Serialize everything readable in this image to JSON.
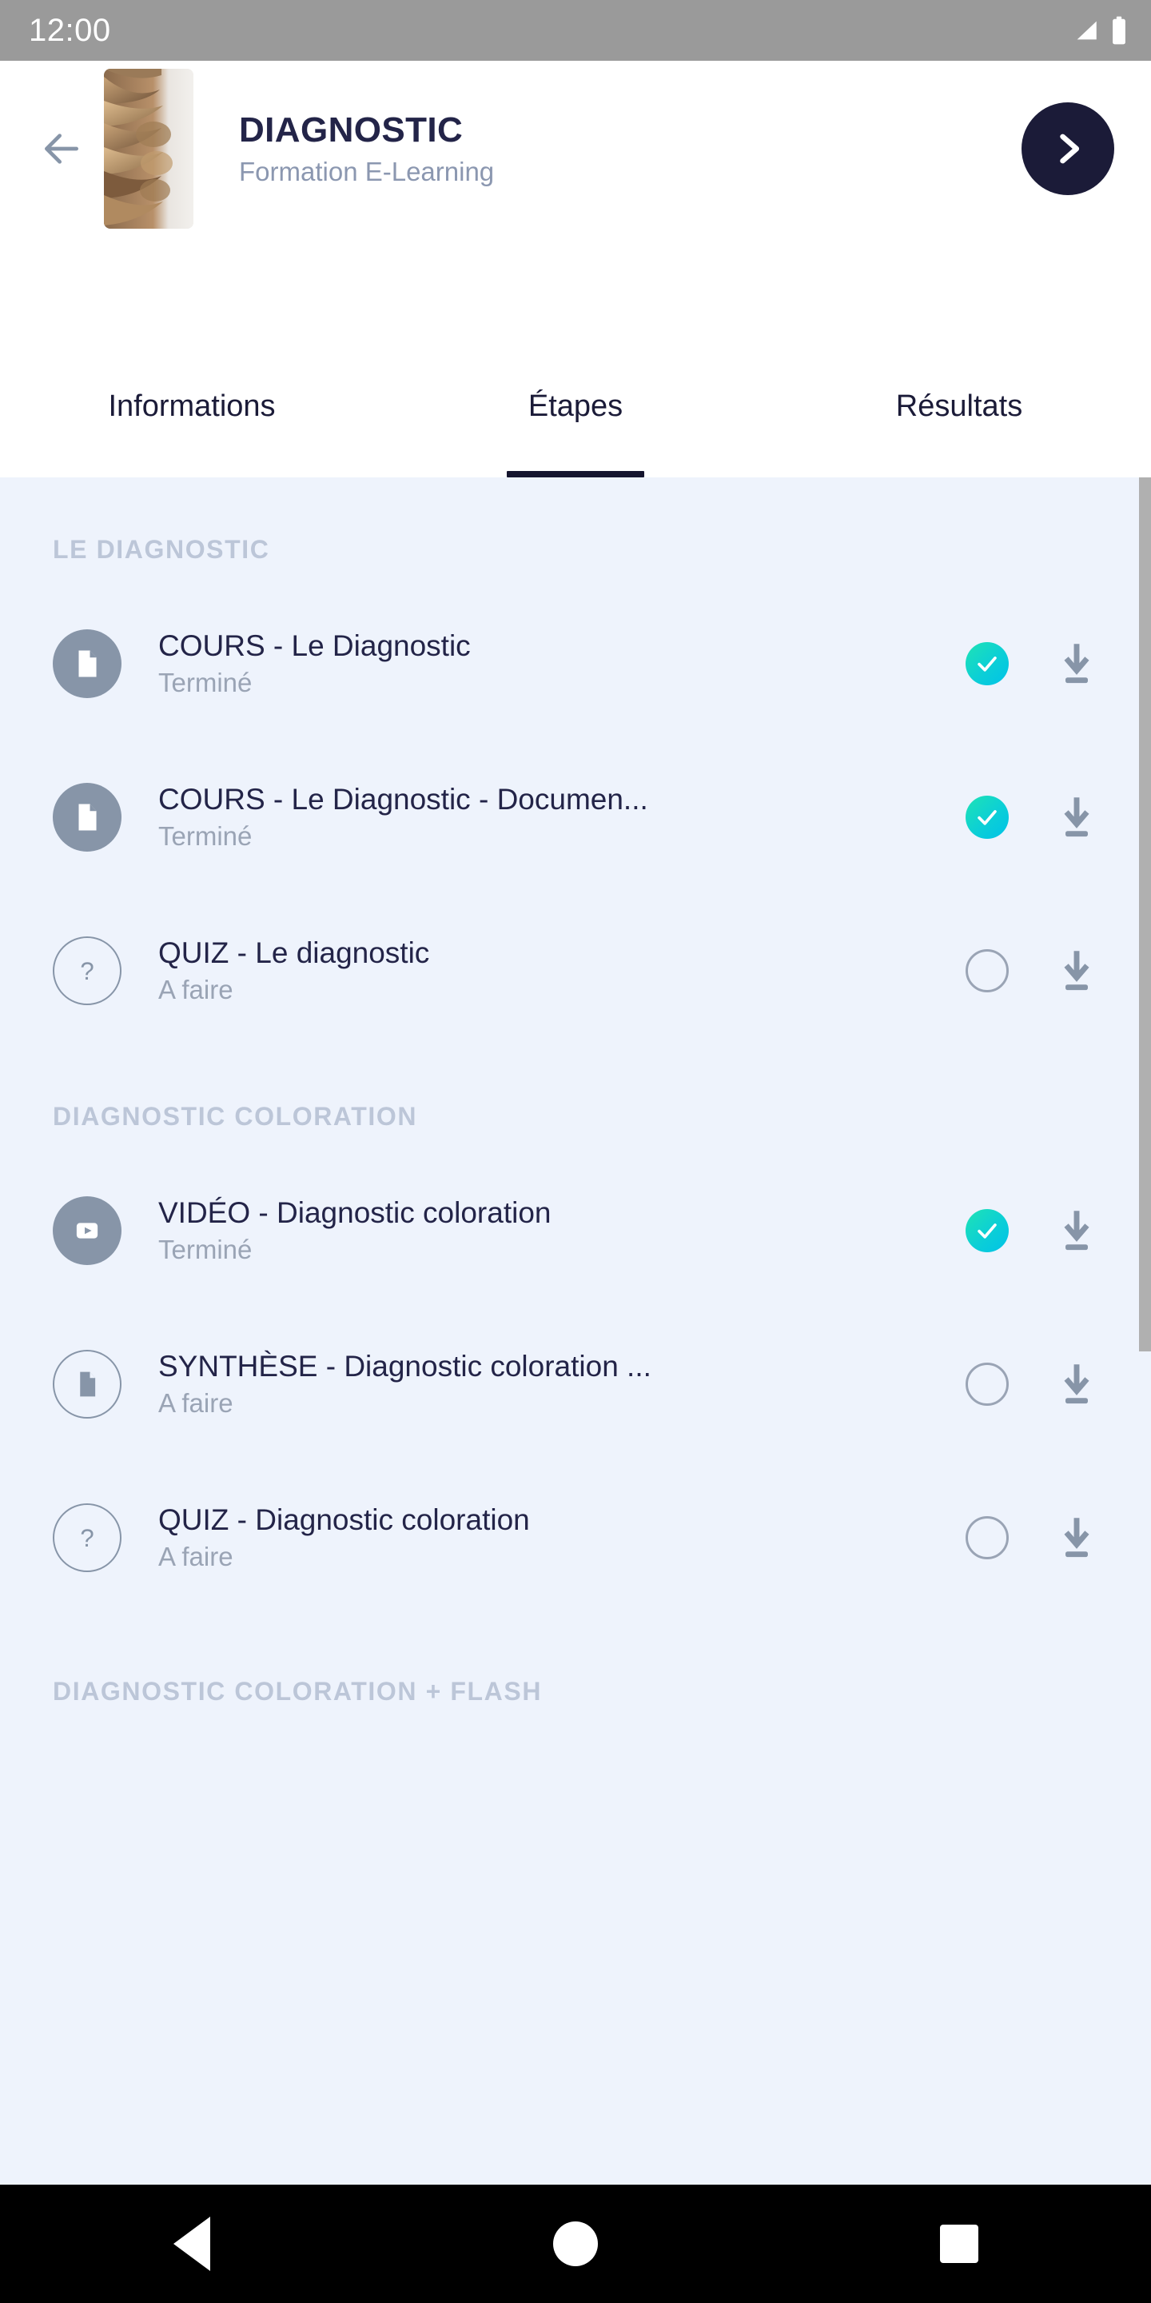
{
  "status_bar": {
    "time": "12:00",
    "signal_icon": "signal-bars-icon",
    "battery_icon": "battery-full-icon",
    "background_color": "#9a9a9a"
  },
  "header": {
    "back_icon": "arrow-left-icon",
    "thumbnail_alt": "braided-hair-photo",
    "title": "DIAGNOSTIC",
    "subtitle": "Formation E-Learning",
    "next_icon": "chevron-right-icon",
    "next_button_color": "#1b1b38",
    "title_color": "#232448",
    "subtitle_color": "#8b97b0"
  },
  "tabs": [
    {
      "label": "Informations",
      "active": false
    },
    {
      "label": "Étapes",
      "active": true
    },
    {
      "label": "Résultats",
      "active": false
    }
  ],
  "colors": {
    "page_background": "#eef3fc",
    "accent_done_start": "#1fe3b4",
    "accent_done_end": "#00c2e8",
    "icon_gray": "#8795a8",
    "section_head": "#bcc6d8",
    "subtitle_gray": "#9aa4b5"
  },
  "sections": [
    {
      "heading": "LE DIAGNOSTIC",
      "items": [
        {
          "type_icon": "document-icon",
          "icon_style": "filled",
          "title": "COURS - Le Diagnostic",
          "status_label": "Terminé",
          "completed": true,
          "download_icon": "download-icon"
        },
        {
          "type_icon": "document-icon",
          "icon_style": "filled",
          "title": "COURS - Le Diagnostic - Documen...",
          "status_label": "Terminé",
          "completed": true,
          "download_icon": "download-icon"
        },
        {
          "type_icon": "question-mark-icon",
          "icon_style": "outlined",
          "title": "QUIZ - Le diagnostic",
          "status_label": "A faire",
          "completed": false,
          "download_icon": "download-icon"
        }
      ]
    },
    {
      "heading": "DIAGNOSTIC COLORATION",
      "items": [
        {
          "type_icon": "video-play-icon",
          "icon_style": "filled",
          "title": "VIDÉO - Diagnostic coloration",
          "status_label": "Terminé",
          "completed": true,
          "download_icon": "download-icon"
        },
        {
          "type_icon": "document-icon",
          "icon_style": "outlined",
          "title": "SYNTHÈSE - Diagnostic coloration ...",
          "status_label": "A faire",
          "completed": false,
          "download_icon": "download-icon"
        },
        {
          "type_icon": "question-mark-icon",
          "icon_style": "outlined",
          "title": "QUIZ - Diagnostic coloration",
          "status_label": "A faire",
          "completed": false,
          "download_icon": "download-icon"
        }
      ]
    },
    {
      "heading": "DIAGNOSTIC COLORATION + FLASH",
      "items": []
    }
  ],
  "nav_bar": {
    "back_icon": "android-back-icon",
    "home_icon": "android-home-icon",
    "recents_icon": "android-recents-icon"
  }
}
